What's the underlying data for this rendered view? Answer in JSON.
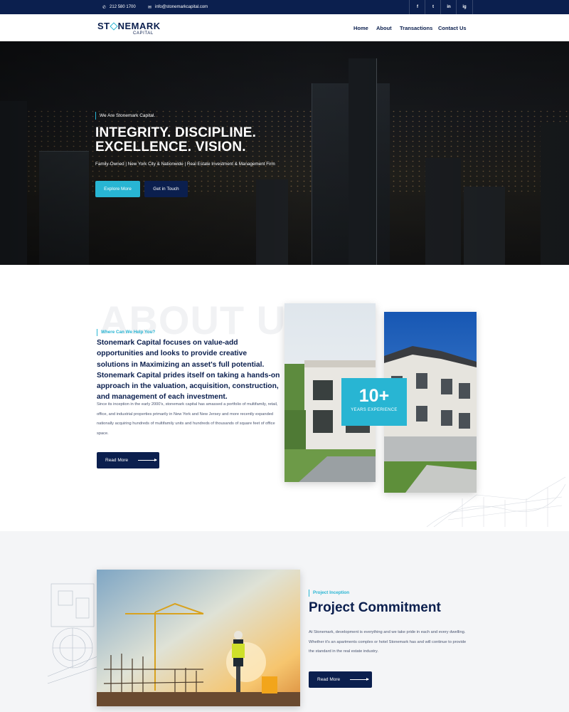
{
  "topbar": {
    "phone": "212 580 1700",
    "email": "info@stonemarkcapital.com",
    "social": [
      "f",
      "t",
      "in",
      "ig"
    ]
  },
  "header": {
    "logo_main_left": "ST",
    "logo_main_right": "NEMARK",
    "logo_sub": "CAPITAL",
    "nav": [
      "Home",
      "About",
      "Transactions",
      "Contact Us"
    ]
  },
  "hero": {
    "eyebrow": "We Are Stonemark Capital.",
    "title_line1": "INTEGRITY. DISCIPLINE.",
    "title_line2": "EXCELLENCE. VISION.",
    "subtitle": "Family-Owned | New York City & Nationwide | Real Estate Investment & Management Firm",
    "btn_explore": "Explore More",
    "btn_touch": "Get in Touch"
  },
  "about": {
    "bg_heading": "ABOUT US",
    "eyebrow": "Where Can We Help You?",
    "lead": "Stonemark Capital focuses on value-add opportunities and looks to provide creative solutions in Maximizing an asset's full potential. Stonemark Capital prides itself on taking a hands-on approach in the valuation, acquisition, construction, and management of each investment.",
    "body": "Since its inception in the early 2000's, stonemark capital has amassed a portfolio of multifamily, retail, office, and industrial properties primarily in New York and New Jersey and more recently expanded nationally acquiring hundreds of multifamily units and hundreds of thousands of square feet of office space.",
    "read_more": "Read More",
    "experience_number": "10+",
    "experience_label": "YEARS EXPERIENCE"
  },
  "project": {
    "eyebrow": "Project Inception",
    "title": "Project Commitment",
    "body": "At Stonemark, development is everything and we take pride in each and every dwelling. Whether it's an apartments complex or hotel Stonemark has and will continue to provide the standard in the real estate industry.",
    "read_more": "Read More"
  },
  "colors": {
    "navy": "#0b1f4e",
    "accent": "#28b5d3"
  }
}
